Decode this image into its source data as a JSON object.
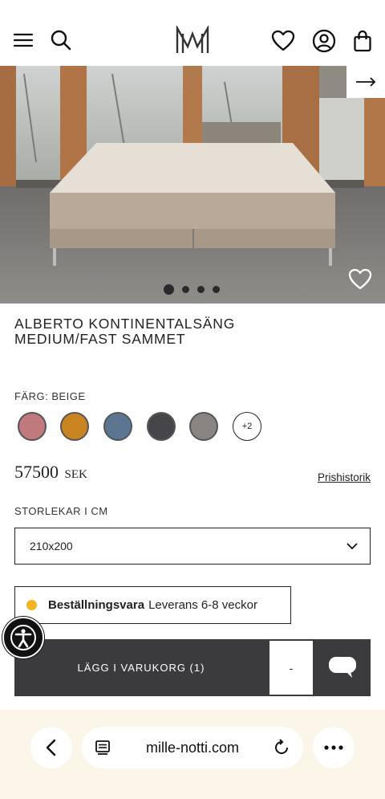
{
  "header": {
    "icons": [
      "menu-icon",
      "search-icon",
      "brand-logo",
      "heart-icon",
      "account-icon",
      "bag-icon"
    ]
  },
  "hero": {
    "image_count": 4,
    "active_index": 0
  },
  "product": {
    "title_line1": "ALBERTO KONTINENTALSÄNG",
    "title_line2": "MEDIUM/FAST SAMMET",
    "color_label": "FÄRG: BEIGE",
    "swatches": [
      "#c07a7e",
      "#c98421",
      "#5c7691",
      "#46454a",
      "#8a8582"
    ],
    "more_colors": "+2",
    "price": "57500",
    "currency": "SEK",
    "price_history": "Prishistorik",
    "sizes_label": "STORLEKAR I CM",
    "size_selected": "210x200",
    "delivery_bold": "Beställningsvara",
    "delivery_text": "Leverans 6-8 veckor"
  },
  "cart": {
    "add_label": "LÄGG I VARUKORG (1)",
    "qty_label": "-"
  },
  "browser": {
    "url": "mille-notti.com"
  },
  "colors": {
    "dark_button": "#3b3b3d",
    "status_dot": "#f2b422",
    "browser_bar": "#fbf5ea"
  }
}
